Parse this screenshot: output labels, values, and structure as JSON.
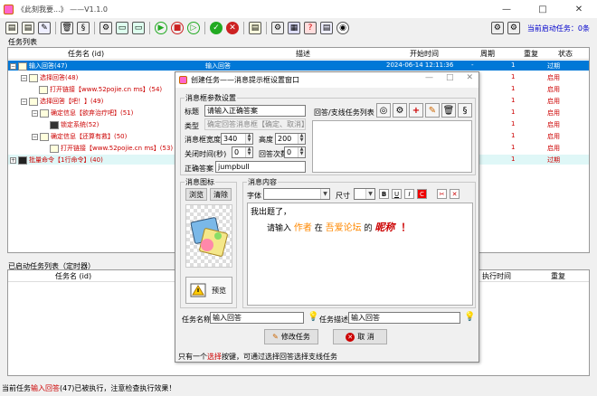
{
  "app": {
    "title": "《此刻我要...》  ——V1.1.0",
    "window_controls": [
      "—",
      "□",
      "✕"
    ]
  },
  "toolbar": {
    "status_label": "当前启动任务：0条"
  },
  "task_list": {
    "section_label": "任务列表",
    "columns": [
      "任务名 (id)",
      "描述",
      "开始时间",
      "周期",
      "重复",
      "状态"
    ],
    "rows": [
      {
        "name": "输入回答(47)",
        "desc": "输入回答",
        "time": "2024-06-14 12:11:36",
        "period": "-",
        "repeat": "1",
        "status": "过期",
        "selected": true
      },
      {
        "name": "选择回答(48)",
        "desc": "",
        "time": "",
        "period": "",
        "repeat": "1",
        "status": "启用"
      },
      {
        "name": "打开链接【www.52pojie.cn ms】(54)",
        "desc": "",
        "time": "",
        "period": "",
        "repeat": "1",
        "status": "启用"
      },
      {
        "name": "选择回答【吧！】(49)",
        "desc": "",
        "time": "",
        "period": "",
        "repeat": "1",
        "status": "启用"
      },
      {
        "name": "确定信息【欲弃治疗吧】(51)",
        "desc": "",
        "time": "",
        "period": "",
        "repeat": "1",
        "status": "启用"
      },
      {
        "name": "锁定系统(52)",
        "desc": "",
        "time": "",
        "period": "",
        "repeat": "1",
        "status": "启用"
      },
      {
        "name": "确定信息【还算有救】(50)",
        "desc": "",
        "time": "",
        "period": "",
        "repeat": "1",
        "status": "启用"
      },
      {
        "name": "打开链接【www.52pojie.cn ms】(53)",
        "desc": "",
        "time": "",
        "period": "",
        "repeat": "1",
        "status": "启用"
      },
      {
        "name": "批量命令【1行命令】(40)",
        "desc": "",
        "time": "",
        "period": "",
        "repeat": "1",
        "status": "过期"
      }
    ]
  },
  "started_list": {
    "section_label": "已启动任务列表（定时器）",
    "columns": [
      "任务名 (id)",
      "执行时间",
      "重复"
    ]
  },
  "bottom": {
    "prefix": "当前任务",
    "task": "输入回答",
    "task_id": "(47)",
    "suffix": "已被执行，注意检查执行效果！"
  },
  "dialog": {
    "title": "创建任务——消息提示框设置窗口",
    "param_group": "消息框参数设置",
    "title_label": "标题",
    "title_value": "请输入正确答案",
    "type_label": "类型",
    "type_value": "确定回答消息框【确定、取消】",
    "width_label": "消息框宽度",
    "width_value": "340",
    "height_label": "高度",
    "height_value": "200",
    "close_label": "关闭时间(秒)",
    "close_value": "0",
    "answer_count_label": "回答次数",
    "answer_count_value": "0",
    "correct_label": "正确答案",
    "correct_value": "jumpbull",
    "branch_label": "回答/支线任务列表",
    "icon_group": "消息图标",
    "browse_button": "浏览",
    "clear_button": "清除",
    "preview_button": "预览",
    "content_group": "消息内容",
    "font_label": "字体",
    "size_label": "尺寸",
    "fmt_buttons": [
      "B",
      "U",
      "I",
      "C"
    ],
    "msg_line1": "我出题了，",
    "msg_l2_a": "请输入",
    "msg_l2_b": "作者",
    "msg_l2_c": "在",
    "msg_l2_d": "吾爱论坛",
    "msg_l2_e": "的",
    "msg_l2_f": "昵称",
    "msg_l2_g": "！",
    "task_name_label": "任务名称",
    "task_name_value": "输入回答",
    "task_desc_label": "任务描述",
    "task_desc_value": "输入回答",
    "modify_button": "修改任务",
    "cancel_button": "取 消",
    "hint_prefix": "只有一个",
    "hint_link": "选择",
    "hint_suffix": "按键，可通过选择回答选择支线任务",
    "colors": {
      "accent_red": "#cc0000",
      "blue": "#0000cc",
      "orange": "#ff8800"
    }
  }
}
